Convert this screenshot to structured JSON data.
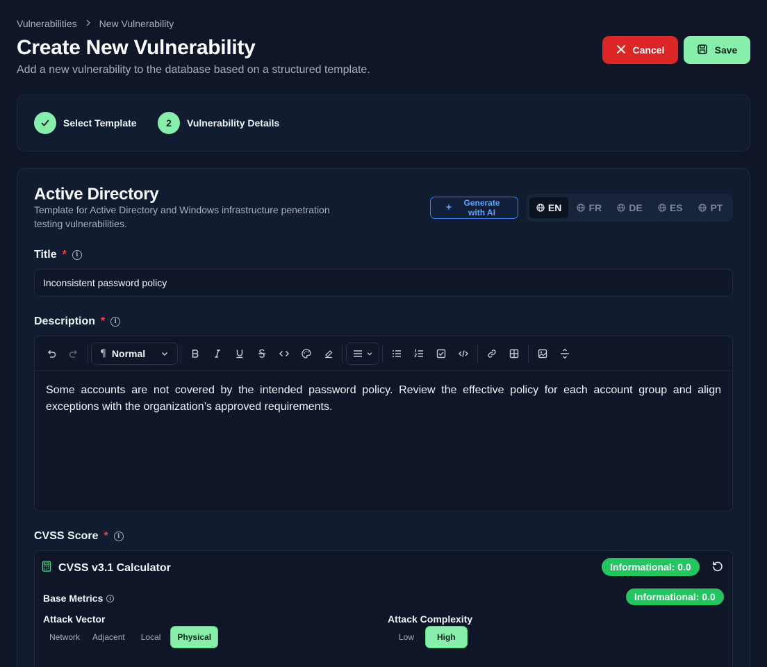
{
  "breadcrumb": {
    "parent": "Vulnerabilities",
    "current": "New Vulnerability"
  },
  "header": {
    "title": "Create New Vulnerability",
    "subtitle": "Add a new vulnerability to the database based on a structured template.",
    "cancel_label": "Cancel",
    "save_label": "Save"
  },
  "steps": [
    {
      "label": "Select Template",
      "state": "done",
      "icon": "check-icon"
    },
    {
      "label": "Vulnerability Details",
      "number": "2",
      "state": "current"
    }
  ],
  "template": {
    "name": "Active Directory",
    "description": "Template for Active Directory and Windows infrastructure penetration testing vulnerabilities.",
    "generate_label": "Generate with AI",
    "languages": [
      "EN",
      "FR",
      "DE",
      "ES",
      "PT"
    ],
    "active_language": "EN"
  },
  "form": {
    "title_label": "Title",
    "title_value": "Inconsistent password policy",
    "description_label": "Description",
    "description_value": "Some accounts are not covered by the intended password policy. Review the effective policy for each account group and align exceptions with the organization’s approved requirements.",
    "required_mark": "*",
    "info_glyph": "i"
  },
  "editor": {
    "block_type": "Normal"
  },
  "cvss": {
    "label": "CVSS Score",
    "calculator_title": "CVSS v3.1 Calculator",
    "overall_badge": "Informational: 0.0",
    "base_metrics_label": "Base Metrics",
    "base_badge": "Informational: 0.0",
    "attack_vector": {
      "label": "Attack Vector",
      "options": [
        "Network",
        "Adjacent",
        "Local",
        "Physical"
      ],
      "selected": "Physical"
    },
    "attack_complexity": {
      "label": "Attack Complexity",
      "options": [
        "Low",
        "High"
      ],
      "selected": "High"
    }
  },
  "colors": {
    "accent_green": "#86efac",
    "danger": "#dc2626",
    "badge_green": "#22c55e",
    "ai_blue": "#60a5fa"
  }
}
